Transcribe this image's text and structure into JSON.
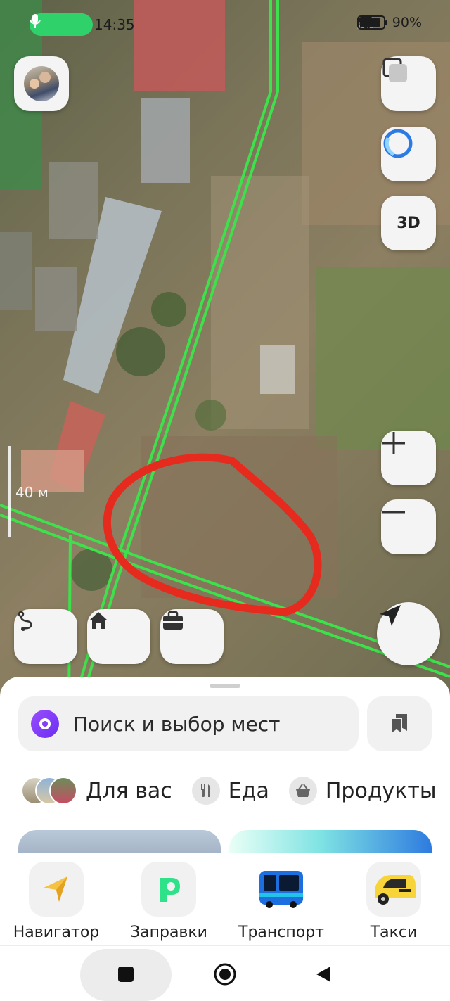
{
  "status_bar": {
    "time": "14:35",
    "battery": "90%",
    "battery_level": 0.9,
    "icons": [
      "mic-icon",
      "location-arrow-icon",
      "signal-icon",
      "roaming-icon",
      "signal-icon",
      "wifi-icon",
      "battery-icon"
    ]
  },
  "map": {
    "scale_label": "40 м",
    "buttons": {
      "three_d": "3D"
    },
    "annotation_color": "#e62a1e",
    "road_color": "#3ee04b"
  },
  "quick_places": [
    "route-icon",
    "home-icon",
    "briefcase-icon"
  ],
  "search": {
    "placeholder": "Поиск и выбор мест"
  },
  "categories": [
    {
      "label": "Для вас",
      "icon": "photo-stack"
    },
    {
      "label": "Еда",
      "icon": "fork-knife-icon"
    },
    {
      "label": "Продукты",
      "icon": "basket-icon"
    }
  ],
  "tabs": [
    {
      "label": "Навигатор",
      "icon": "navigator-arrow-icon",
      "color": "#f6c244"
    },
    {
      "label": "Заправки",
      "icon": "fuel-p-icon",
      "color": "#2ee28a"
    },
    {
      "label": "Транспорт",
      "icon": "bus-icon",
      "color": "#1da8e0"
    },
    {
      "label": "Такси",
      "icon": "taxi-car-icon",
      "color": "#f6d43a"
    }
  ],
  "system_nav": [
    "recents-icon",
    "home-circle-icon",
    "back-icon"
  ]
}
